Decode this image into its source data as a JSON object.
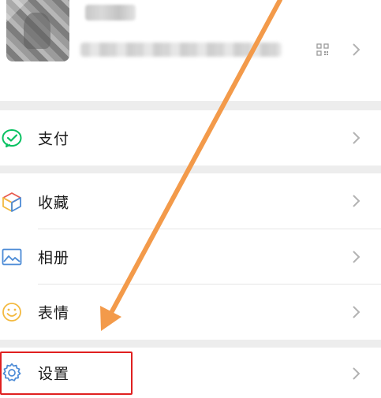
{
  "menu": {
    "items": [
      {
        "label": "支付",
        "icon": "wechat-pay-icon"
      },
      {
        "label": "收藏",
        "icon": "favorites-cube-icon"
      },
      {
        "label": "相册",
        "icon": "album-image-icon"
      },
      {
        "label": "表情",
        "icon": "sticker-smile-icon"
      },
      {
        "label": "设置",
        "icon": "settings-gear-icon"
      }
    ]
  },
  "colors": {
    "background": "#ededed",
    "card": "#ffffff",
    "pay_green": "#07c160",
    "album_blue": "#4c8bd6",
    "sticker_yellow": "#f3b93f",
    "settings_blue": "#4c8bd6",
    "annotation_orange": "#f39a4a",
    "annotation_red": "#e02020"
  }
}
